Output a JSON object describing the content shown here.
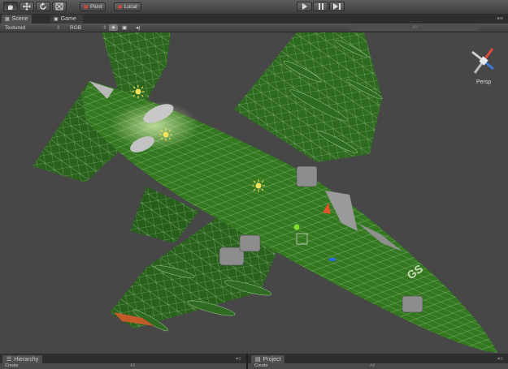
{
  "toolbar": {
    "tools": [
      {
        "name": "hand-tool",
        "icon": "hand-icon"
      },
      {
        "name": "move-tool",
        "icon": "move-arrows-icon"
      },
      {
        "name": "rotate-tool",
        "icon": "rotate-icon"
      },
      {
        "name": "scale-tool",
        "icon": "scale-icon"
      }
    ],
    "pivot_label": "Pivot",
    "local_label": "Local",
    "play_icon": "play-icon",
    "pause_icon": "pause-icon",
    "step_icon": "step-icon",
    "accent_pivot": "#c84a3a",
    "accent_local": "#c84a3a"
  },
  "tabs": {
    "scene_label": "Scene",
    "game_label": "Game"
  },
  "scene_bar": {
    "draw_mode": "Textured",
    "render_mode": "RGB",
    "search_placeholder": "All"
  },
  "gizmo": {
    "projection_label": "Persp",
    "x_color": "#d84a3a",
    "y_color": "#9fd15a",
    "z_color": "#3a7ad8"
  },
  "bottom_panels": {
    "hierarchy_label": "Hierarchy",
    "hierarchy_create": "Create",
    "hierarchy_search": "All",
    "project_label": "Project",
    "project_create": "Create",
    "project_search": "All"
  },
  "colors": {
    "mesh_green": "#2f6a22",
    "wire": "#bfe5b8",
    "light_gizmo": "#f2e25a"
  }
}
